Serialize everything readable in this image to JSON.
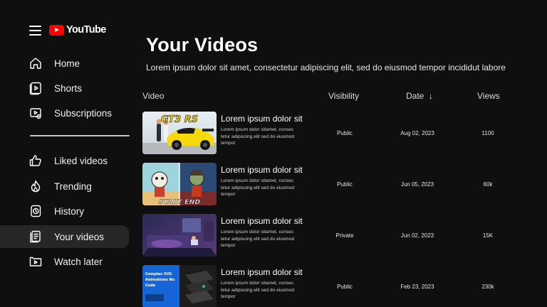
{
  "app": {
    "logo_text": "YouTube"
  },
  "sidebar": {
    "items": [
      {
        "label": "Home",
        "icon": "home-icon"
      },
      {
        "label": "Shorts",
        "icon": "shorts-icon"
      },
      {
        "label": "Subscriptions",
        "icon": "subscriptions-icon"
      },
      {
        "label": "Liked videos",
        "icon": "thumbs-up-icon"
      },
      {
        "label": "Trending",
        "icon": "flame-icon"
      },
      {
        "label": "History",
        "icon": "history-icon"
      },
      {
        "label": "Your videos",
        "icon": "your-videos-icon",
        "active": true
      },
      {
        "label": "Watch later",
        "icon": "watch-later-icon"
      }
    ]
  },
  "main": {
    "title": "Your Videos",
    "subtitle": "Lorem ipsum dolor sit amet, consectetur adipiscing elit, sed do eiusmod tempor incididut labore",
    "columns": {
      "video": "Video",
      "visibility": "Visibility",
      "date": "Date",
      "date_sort_icon": "arrow-down-icon",
      "views": "Views"
    },
    "videos": [
      {
        "title": "Lorem ipsum dolor sit",
        "description": "Lorem ipsum dolor sitamet, consec tetur adipiscing elit sed do eiusmod tempor",
        "visibility": "Public",
        "date": "Aug 02, 2023",
        "views": "1100",
        "thumbnail_text": "GT3 RS"
      },
      {
        "title": "Lorem ipsum dolor sit",
        "description": "Lorem ipsum dolor sitamet, consec tetur adipiscing elit sed do eiusmod tempor",
        "visibility": "Public",
        "date": "Jun 05, 2023",
        "views": "60k",
        "thumbnail_text": "START END"
      },
      {
        "title": "Lorem ipsum dolor sit",
        "description": "Lorem ipsum dolor sitamet, consec tetur adipiscing elit sed do eiusmod tempor",
        "visibility": "Private",
        "date": "Jun 02, 2023",
        "views": "15K",
        "thumbnail_text": ""
      },
      {
        "title": "Lorem ipsum dolor sit",
        "description": "Lorem ipsum dolor sitamet, consec tetur adipiscing elit sed do eiusmod tempor",
        "visibility": "Public",
        "date": "Feb 23, 2023",
        "views": "230k",
        "thumbnail_text": "Complex SVG Animations No Code"
      }
    ]
  },
  "colors": {
    "background": "#0f0f0f",
    "active_item": "#272727",
    "brand_red": "#ff0000",
    "accent_yellow": "#f5d90a",
    "accent_blue": "#1565d8"
  }
}
